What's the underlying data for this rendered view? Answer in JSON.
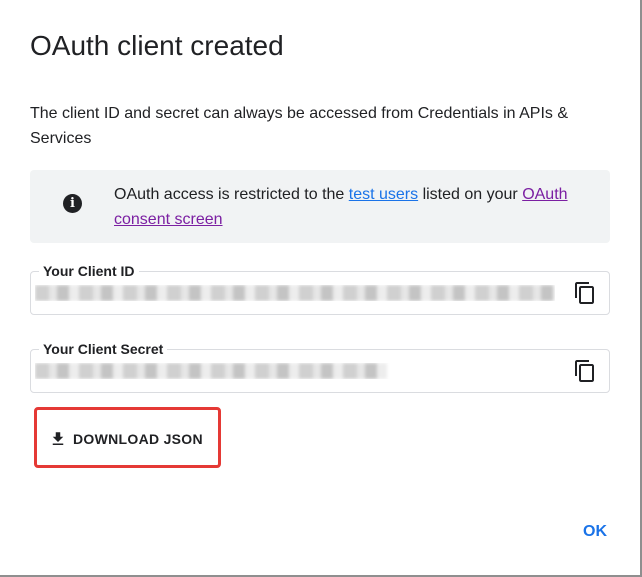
{
  "dialog": {
    "title": "OAuth client created",
    "description": "The client ID and secret can always be accessed from Credentials in APIs & Services"
  },
  "info": {
    "icon": "info-icon",
    "text_before": "OAuth access is restricted to the ",
    "link_test_users": "test users",
    "text_middle": " listed on your ",
    "link_consent": "OAuth consent screen"
  },
  "client_id": {
    "label": "Your Client ID",
    "value_redacted": true,
    "copy_icon": "copy-icon"
  },
  "client_secret": {
    "label": "Your Client Secret",
    "value_redacted": true,
    "copy_icon": "copy-icon"
  },
  "actions": {
    "download_label": "DOWNLOAD JSON",
    "download_icon": "download-icon",
    "ok_label": "OK"
  },
  "colors": {
    "accent_blue": "#1a73e8",
    "link_purple": "#7b1fa2",
    "highlight_red": "#e53935",
    "info_bg": "#f1f3f4"
  }
}
